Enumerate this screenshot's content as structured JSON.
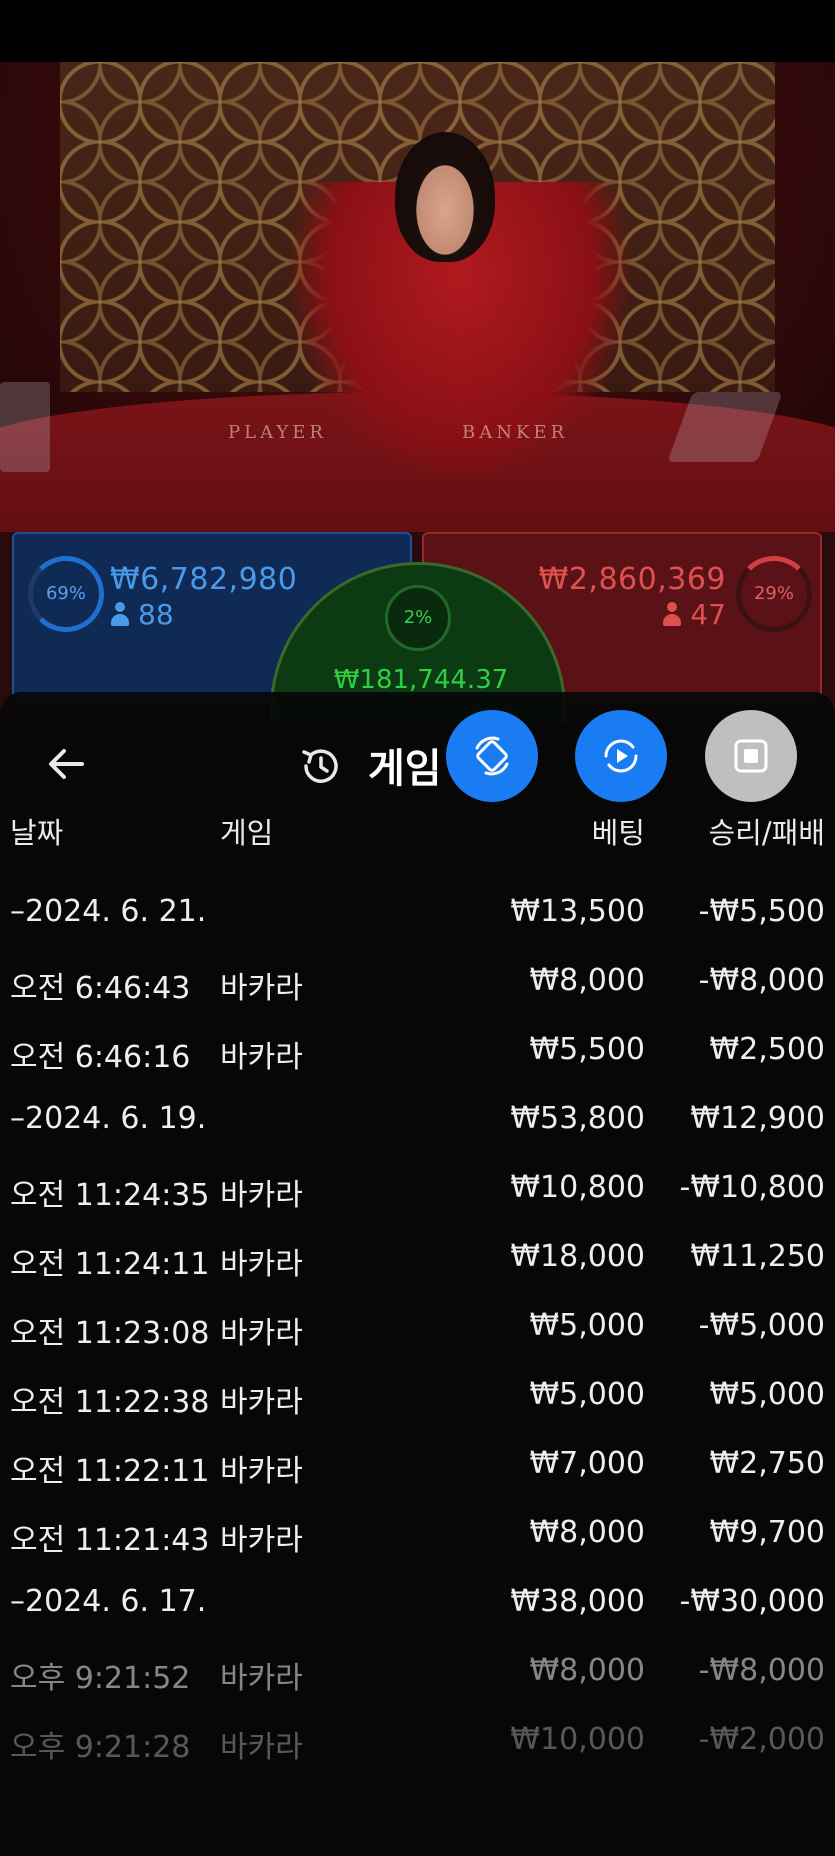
{
  "video": {
    "felt_player_label": "PLAYER",
    "felt_banker_label": "BANKER"
  },
  "bets": {
    "player": {
      "percent": "69%",
      "amount": "₩6,782,980",
      "players": "88"
    },
    "banker": {
      "percent": "29%",
      "amount": "₩2,860,369",
      "players": "47"
    },
    "tie": {
      "percent": "2%",
      "amount": "₩181,744.37"
    }
  },
  "header": {
    "title": "게임"
  },
  "columns": {
    "date": "날짜",
    "game": "게임",
    "bet": "베팅",
    "result": "승리/패배"
  },
  "rows": [
    {
      "type": "group",
      "date": "–2024. 6. 21.",
      "game": "",
      "bet": "₩13,500",
      "result": "-₩5,500"
    },
    {
      "type": "item",
      "date": "오전 6:46:43",
      "game": "바카라",
      "bet": "₩8,000",
      "result": "-₩8,000"
    },
    {
      "type": "item",
      "date": "오전 6:46:16",
      "game": "바카라",
      "bet": "₩5,500",
      "result": "₩2,500"
    },
    {
      "type": "group",
      "date": "–2024. 6. 19.",
      "game": "",
      "bet": "₩53,800",
      "result": "₩12,900"
    },
    {
      "type": "item",
      "date": "오전 11:24:35",
      "game": "바카라",
      "bet": "₩10,800",
      "result": "-₩10,800"
    },
    {
      "type": "item",
      "date": "오전 11:24:11",
      "game": "바카라",
      "bet": "₩18,000",
      "result": "₩11,250"
    },
    {
      "type": "item",
      "date": "오전 11:23:08",
      "game": "바카라",
      "bet": "₩5,000",
      "result": "-₩5,000"
    },
    {
      "type": "item",
      "date": "오전 11:22:38",
      "game": "바카라",
      "bet": "₩5,000",
      "result": "₩5,000"
    },
    {
      "type": "item",
      "date": "오전 11:22:11",
      "game": "바카라",
      "bet": "₩7,000",
      "result": "₩2,750"
    },
    {
      "type": "item",
      "date": "오전 11:21:43",
      "game": "바카라",
      "bet": "₩8,000",
      "result": "₩9,700"
    },
    {
      "type": "group",
      "date": "–2024. 6. 17.",
      "game": "",
      "bet": "₩38,000",
      "result": "-₩30,000"
    },
    {
      "type": "item",
      "date": "오후 9:21:52",
      "game": "바카라",
      "bet": "₩8,000",
      "result": "-₩8,000"
    },
    {
      "type": "item",
      "date": "오후 9:21:28",
      "game": "바카라",
      "bet": "₩10,000",
      "result": "-₩2,000"
    }
  ],
  "icons": {
    "back": "arrow-left-icon",
    "history": "history-icon",
    "rotate": "rotate-screen-icon",
    "replay": "replay-icon",
    "stop": "stop-icon"
  },
  "colors": {
    "player_blue": "#1d4f9a",
    "banker_red": "#9a2a2a",
    "tie_green": "#2fcf44",
    "fab_blue": "#1a7cf2",
    "fab_gray": "#bfbfbf"
  }
}
